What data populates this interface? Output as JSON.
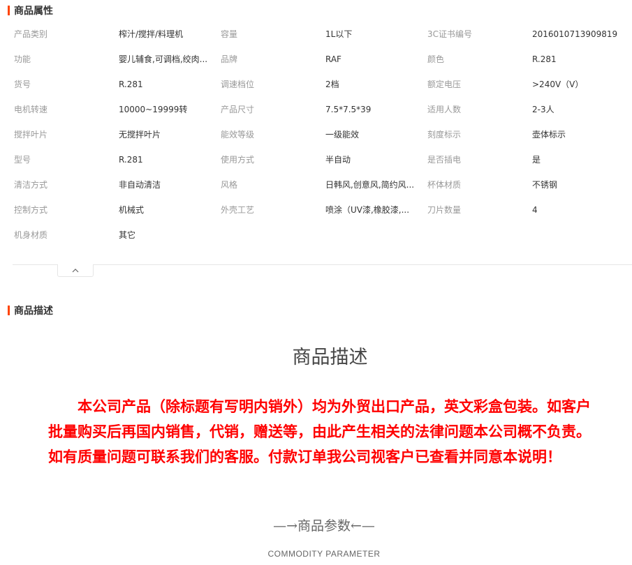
{
  "attributes_section": {
    "title": "商品属性"
  },
  "attributes": [
    [
      [
        "产品类别",
        "榨汁/搅拌/料理机"
      ],
      [
        "容量",
        "1L以下"
      ],
      [
        "3C证书编号",
        "2016010713909819"
      ]
    ],
    [
      [
        "功能",
        "婴儿辅食,可调档,绞肉..."
      ],
      [
        "品牌",
        "RAF"
      ],
      [
        "颜色",
        "R.281"
      ]
    ],
    [
      [
        "货号",
        "R.281"
      ],
      [
        "调速档位",
        "2档"
      ],
      [
        "额定电压",
        "&gt;240V（V）"
      ]
    ],
    [
      [
        "电机转速",
        "10000~19999转"
      ],
      [
        "产品尺寸",
        "7.5*7.5*39"
      ],
      [
        "适用人数",
        "2-3人"
      ]
    ],
    [
      [
        "搅拌叶片",
        "无搅拌叶片"
      ],
      [
        "能效等级",
        "一级能效"
      ],
      [
        "刻度标示",
        "壶体标示"
      ]
    ],
    [
      [
        "型号",
        "R.281"
      ],
      [
        "使用方式",
        "半自动"
      ],
      [
        "是否插电",
        "是"
      ]
    ],
    [
      [
        "清洁方式",
        "非自动清洁"
      ],
      [
        "风格",
        "日韩风,创意风,简约风..."
      ],
      [
        "杯体材质",
        "不锈钢"
      ]
    ],
    [
      [
        "控制方式",
        "机械式"
      ],
      [
        "外壳工艺",
        "喷涂（UV漆,橡胶漆,..."
      ],
      [
        "刀片数量",
        "4"
      ]
    ],
    [
      [
        "机身材质",
        "其它"
      ]
    ]
  ],
  "collapse_icon": "chevron-up-icon",
  "description_section": {
    "title": "商品描述",
    "heading": "商品描述",
    "notice": "本公司产品（除标题有写明内销外）均为外贸出口产品，英文彩盒包装。如客户批量购买后再国内销售，代销，赠送等，由此产生相关的法律问题本公司概不负责。如有质量问题可联系我们的客服。付款订单我公司视客户已查看并同意本说明！",
    "param_heading": "—→商品参数←—",
    "param_subheading": "COMMODITY  PARAMETER"
  },
  "colors": {
    "accent": "#ff4400",
    "notice": "#ff0000",
    "label": "#999999",
    "value": "#333333"
  }
}
